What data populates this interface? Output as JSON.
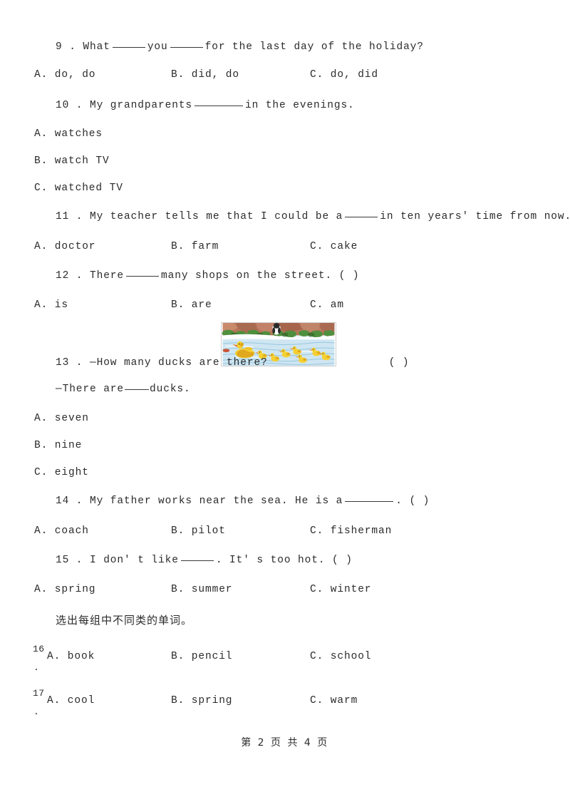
{
  "document": {
    "type": "english-exam-paper",
    "footer": "第 2 页 共 4 页"
  },
  "questions": [
    {
      "number": "9",
      "stem": "9 . What ______ you ______ for the last day of the holiday?",
      "stem_prefix": "9 . What",
      "stem_mid": "you",
      "stem_suffix": "for the last day of the holiday?",
      "options": [
        "A. do, do",
        "B. did, do",
        "C. do, did"
      ],
      "layout": "row"
    },
    {
      "number": "10",
      "stem_prefix": "10 . My grandparents",
      "stem_suffix": "in the evenings.",
      "options": [
        "A. watches",
        "B. watch TV",
        "C. watched TV"
      ],
      "layout": "stacked"
    },
    {
      "number": "11",
      "stem_prefix": "11 . My teacher tells me that I could be a",
      "stem_suffix": "in ten years' time from now.  (    )",
      "options": [
        "A. doctor",
        "B. farm",
        "C. cake"
      ],
      "layout": "row"
    },
    {
      "number": "12",
      "stem_prefix": "12 . There",
      "stem_suffix": "many shops on the street.  (    )",
      "options": [
        "A. is",
        "B. are",
        "C. am"
      ],
      "layout": "row"
    },
    {
      "number": "13",
      "stem_prefix": "13 . —How many ducks are there?",
      "stem_suffix": "(    )",
      "stem_line2_prefix": "—There are",
      "stem_line2_suffix": "ducks.",
      "options": [
        "A. seven",
        "B. nine",
        "C. eight"
      ],
      "layout": "stacked",
      "has_image": true
    },
    {
      "number": "14",
      "stem_prefix": "14 . My father works near the sea. He is a",
      "stem_suffix": ". (    )",
      "options": [
        "A. coach",
        "B. pilot",
        "C. fisherman"
      ],
      "layout": "row"
    },
    {
      "number": "15",
      "stem_prefix": "15 . I don' t like",
      "stem_suffix": ". It' s too hot.  (    )",
      "options": [
        "A. spring",
        "B. summer",
        "C. winter"
      ],
      "layout": "row"
    }
  ],
  "section_instruction": "选出每组中不同类的单词。",
  "word_groups": [
    {
      "number": "16",
      "dot": ".",
      "options": [
        "A. book",
        "B. pencil",
        "C. school"
      ]
    },
    {
      "number": "17",
      "dot": ".",
      "options": [
        "A. cool",
        "B. spring",
        "C. warm"
      ]
    }
  ],
  "illustration": {
    "name": "ducks-on-pond",
    "description": "A mother duck leading seven ducklings swimming on a pond with a rocky green shore",
    "colors": {
      "water": "#cfe6f2",
      "water_light": "#eaf5fb",
      "duck_body": "#f5d033",
      "duck_shade": "#e0a81e",
      "beak": "#e8732a",
      "rock": "#b5765a",
      "rock_dark": "#97573f",
      "foliage": "#4f8f3d",
      "foliage_dark": "#356b29",
      "bank": "#ffffff"
    },
    "duckling_count": 7
  }
}
